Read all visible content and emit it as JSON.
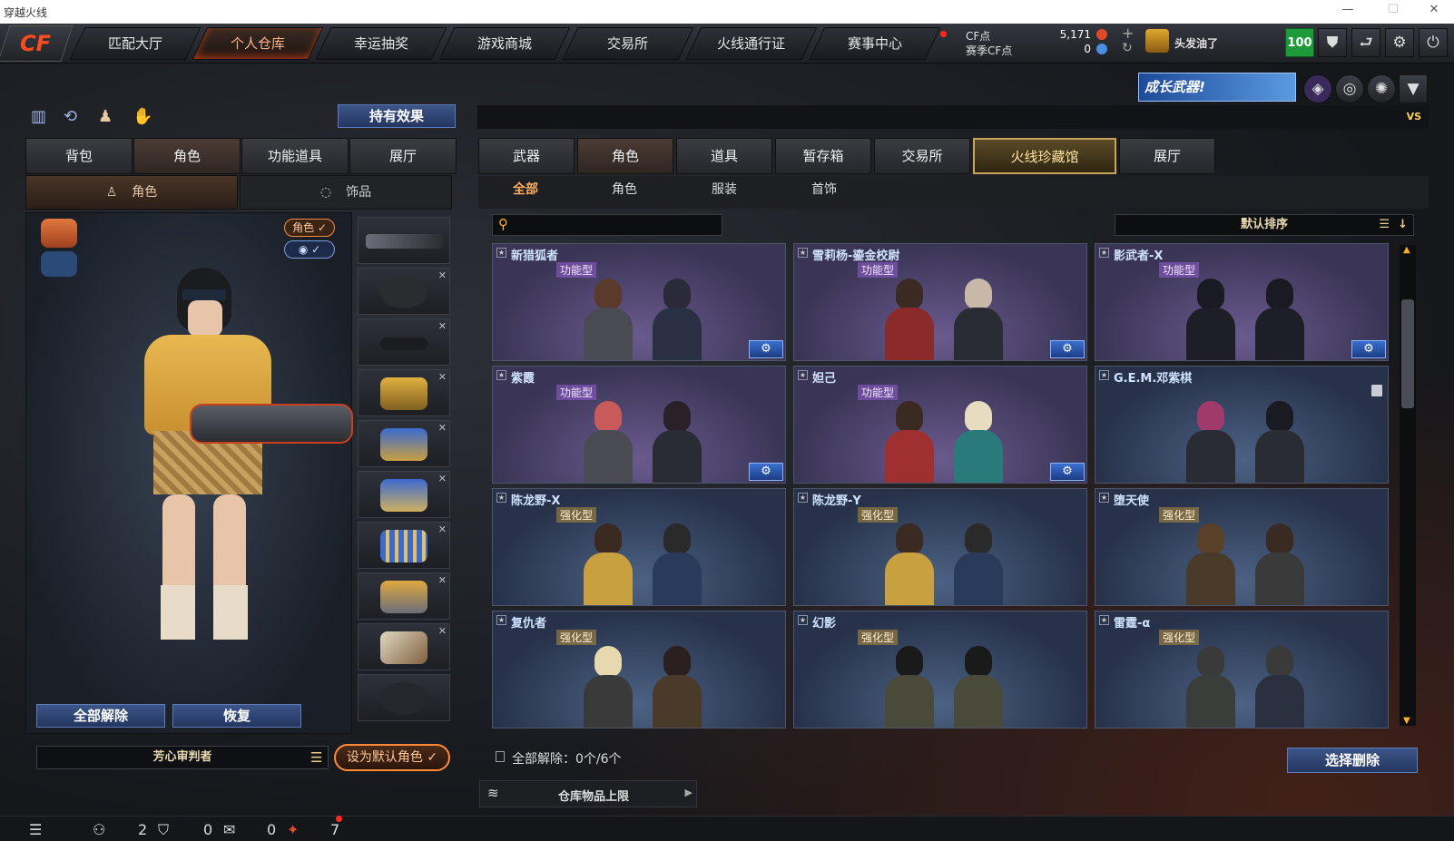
{
  "window": {
    "title": "穿越火线"
  },
  "nav": {
    "logo": "CF",
    "tabs": [
      "匹配大厅",
      "个人仓库",
      "幸运抽奖",
      "游戏商城",
      "交易所",
      "火线通行证",
      "赛事中心"
    ],
    "cf_label": "CF点",
    "season_cf_label": "赛季CF点",
    "cf_value": "5,171",
    "season_cf_value": "0",
    "username": "头发油了",
    "level": "100",
    "banner": "成长武器!"
  },
  "left": {
    "effect_button": "持有效果",
    "tabs": [
      "背包",
      "角色",
      "功能道具",
      "展厅"
    ],
    "subtabs": [
      "角色",
      "饰品"
    ],
    "toggle_role": "角色 ✓",
    "toggle_eye": "✓",
    "unequip_all": "全部解除",
    "restore": "恢复",
    "char_name": "芳心审判者",
    "set_default": "设为默认角色"
  },
  "right": {
    "tabs": [
      "武器",
      "角色",
      "道具",
      "暂存箱",
      "交易所",
      "火线珍藏馆",
      "展厅"
    ],
    "subtabs": [
      "全部",
      "角色",
      "服装",
      "首饰"
    ],
    "search_placeholder": "",
    "sort": "默认排序",
    "vs_label": "VS",
    "cards": [
      {
        "name": "新猎狐者",
        "tag": "功能型"
      },
      {
        "name": "雪莉杨-鎏金校尉",
        "tag": "功能型"
      },
      {
        "name": "影武者-X",
        "tag": "功能型"
      },
      {
        "name": "紫霞",
        "tag": "功能型"
      },
      {
        "name": "妲己",
        "tag": "功能型"
      },
      {
        "name": "G.E.M.邓紫棋",
        "tag": ""
      },
      {
        "name": "陈龙野-X",
        "tag": "强化型"
      },
      {
        "name": "陈龙野-Y",
        "tag": "强化型"
      },
      {
        "name": "堕天使",
        "tag": "强化型"
      },
      {
        "name": "复仇者",
        "tag": "强化型"
      },
      {
        "name": "幻影",
        "tag": "强化型"
      },
      {
        "name": "雷霆-α",
        "tag": "强化型"
      }
    ],
    "unequip_count": "全部解除：0个/6个",
    "select_delete": "选择删除",
    "storage_limit": "仓库物品上限"
  },
  "bottom": {
    "friends": "2",
    "clan": "0",
    "chat": "0",
    "gifts": "7"
  },
  "colors": {
    "accent": "#ff8a3a",
    "purple_card": "#6a5a8e",
    "blue_card": "#4c6284",
    "level_green": "#1f9a3a"
  }
}
